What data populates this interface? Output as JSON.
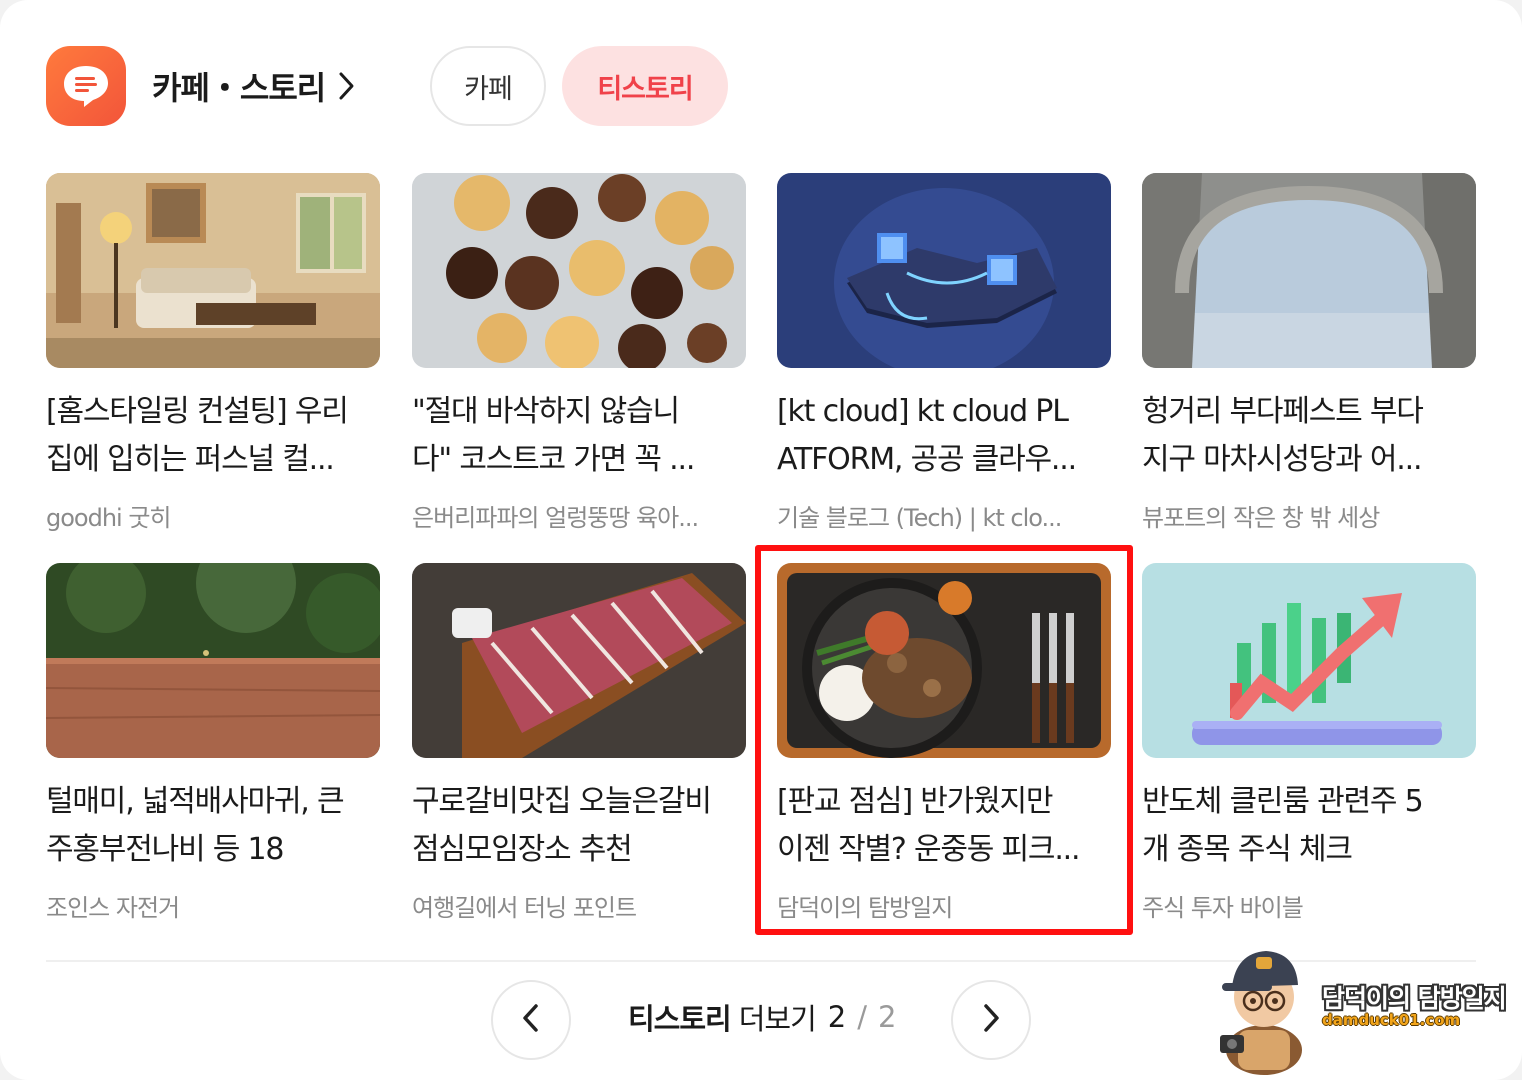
{
  "header": {
    "title": "카페・스토리",
    "icon": "chat-bubble-icon",
    "tabs": [
      {
        "label": "카페",
        "active": false
      },
      {
        "label": "티스토리",
        "active": true
      }
    ]
  },
  "items": [
    {
      "title": "[홈스타일링 컨설팅] 우리\n집에 입히는 퍼스널 컬...",
      "source": "goodhi 굿히",
      "thumb": "living-room-photo"
    },
    {
      "title": "\"절대 바삭하지 않습니\n다\" 코스트코 가면 꼭 ...",
      "source": "은버리파파의 얼렁뚱땅 육아...",
      "thumb": "waffle-cookies-photo"
    },
    {
      "title": "[kt cloud] kt cloud PL\nATFORM, 공공 클라우...",
      "source": "기술 블로그 (Tech) | kt clo...",
      "thumb": "cloud-platform-illustration"
    },
    {
      "title": "헝거리 부다페스트 부다\n지구 마차시성당과 어...",
      "source": "뷰포트의 작은 창 밖 세상",
      "thumb": "stone-arch-photo"
    },
    {
      "title": "털매미, 넓적배사마귀, 큰\n주홍부전나비 등 18",
      "source": "조인스 자전거",
      "thumb": "wooden-rail-photo"
    },
    {
      "title": "구로갈비맛집 오늘은갈비\n점심모임장소 추천",
      "source": "여행길에서 터닝 포인트",
      "thumb": "galbi-ribs-photo"
    },
    {
      "title": "[판교 점심] 반가웠지만\n이젠 작별? 운중동 피크...",
      "source": "담덕이의 탐방일지",
      "thumb": "steak-plate-photo"
    },
    {
      "title": "반도체 클린룸 관련주 5\n개 종목 주식 체크",
      "source": "주식 투자 바이블",
      "thumb": "stock-chart-illustration"
    }
  ],
  "pager": {
    "label_strong": "티스토리",
    "label_more": "더보기",
    "current": "2",
    "separator": "/",
    "total": "2"
  },
  "watermark": {
    "name": "담덕이의 탐방일지",
    "url": "damduck01.com"
  },
  "colors": {
    "accent": "#f0424a",
    "tab_active_bg": "#fde1e1",
    "icon_gradient_start": "#ff7a3d",
    "icon_gradient_end": "#f2553a",
    "highlight_border": "#ff1010"
  }
}
